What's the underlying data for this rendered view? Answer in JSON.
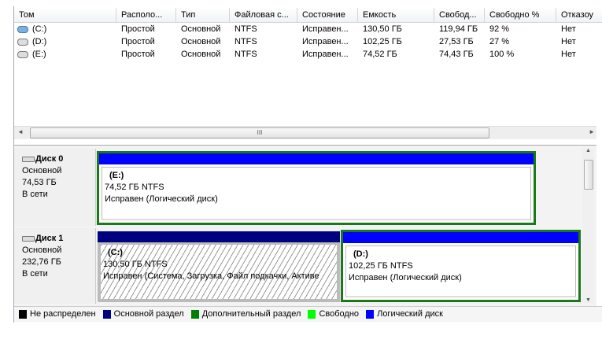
{
  "columns": [
    "Том",
    "Располо...",
    "Тип",
    "Файловая с...",
    "Состояние",
    "Емкость",
    "Свобод...",
    "Свободно %",
    "Отказоу"
  ],
  "volumes": [
    {
      "name": "(C:)",
      "layout": "Простой",
      "type": "Основной",
      "fs": "NTFS",
      "status": "Исправен...",
      "capacity": "130,50 ГБ",
      "free": "119,94 ГБ",
      "free_pct": "92 %",
      "fault": "Нет"
    },
    {
      "name": "(D:)",
      "layout": "Простой",
      "type": "Основной",
      "fs": "NTFS",
      "status": "Исправен...",
      "capacity": "102,25 ГБ",
      "free": "27,53 ГБ",
      "free_pct": "27 %",
      "fault": "Нет"
    },
    {
      "name": "(E:)",
      "layout": "Простой",
      "type": "Основной",
      "fs": "NTFS",
      "status": "Исправен...",
      "capacity": "74,52 ГБ",
      "free": "74,43 ГБ",
      "free_pct": "100 %",
      "fault": "Нет"
    }
  ],
  "disks": [
    {
      "name": "Диск 0",
      "type": "Основной",
      "size": "74,53 ГБ",
      "state": "В сети",
      "partitions": [
        {
          "label": "(E:)",
          "size": "74,52 ГБ NTFS",
          "status": "Исправен (Логический диск)"
        }
      ]
    },
    {
      "name": "Диск 1",
      "type": "Основной",
      "size": "232,76 ГБ",
      "state": "В сети",
      "partitions": [
        {
          "label": "(C:)",
          "size": "130,50 ГБ NTFS",
          "status": "Исправен (Система, Загрузка, Файл подкачки, Активе"
        },
        {
          "label": "(D:)",
          "size": "102,25 ГБ NTFS",
          "status": "Исправен (Логический диск)"
        }
      ]
    }
  ],
  "legend": [
    {
      "label": "Не распределен",
      "color": "#000000"
    },
    {
      "label": "Основной раздел",
      "color": "#000080"
    },
    {
      "label": "Дополнительный раздел",
      "color": "#008000"
    },
    {
      "label": "Свободно",
      "color": "#00ff00"
    },
    {
      "label": "Логический диск",
      "color": "#0000ff"
    }
  ],
  "scroll_grip": "III"
}
